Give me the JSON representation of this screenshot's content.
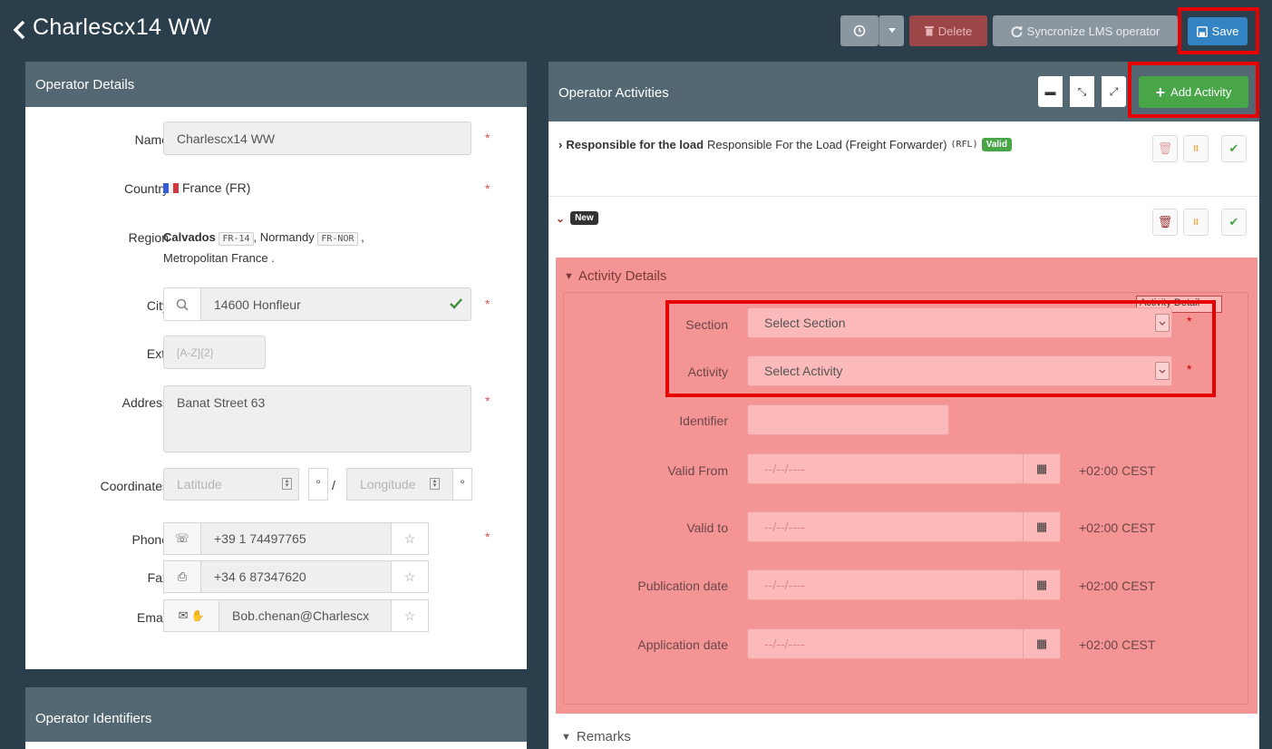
{
  "header": {
    "title": "Charlescx14 WW",
    "delete_label": "Delete",
    "sync_label": "Syncronize LMS operator",
    "save_label": "Save"
  },
  "operator_details": {
    "panel_title": "Operator Details",
    "name_label": "Name",
    "name_value": "Charlescx14 WW",
    "country_label": "Country",
    "country_value": "France (FR)",
    "region_label": "Region",
    "region_name": "Calvados",
    "region_code": "FR-14",
    "region_parent": ", Normandy",
    "region_parent_code": "FR-NOR",
    "region_line2": "Metropolitan France .",
    "city_label": "City",
    "city_value": "14600 Honfleur",
    "ext_label": "Ext.",
    "ext_placeholder": "[A-Z]{2}",
    "address_label": "Address",
    "address_value": "Banat Street 63",
    "coordinates_label": "Coordinates",
    "latitude_placeholder": "Latitude",
    "longitude_placeholder": "Longitude",
    "degree": "°",
    "slash": "/",
    "phone_label": "Phone",
    "phone_value": "+39 1 74497765",
    "fax_label": "Fax",
    "fax_value": "+34 6 87347620",
    "email_label": "Email",
    "email_value": "Bob.chenan@Charlescx"
  },
  "operator_identifiers": {
    "panel_title": "Operator Identifiers"
  },
  "operator_activities": {
    "panel_title": "Operator Activities",
    "add_label": "Add Activity",
    "item1_bold": "Responsible for the load",
    "item1_desc": "Responsible For the Load (Freight Forwarder)",
    "item1_code": "(RFL)",
    "item1_badge": "Valid",
    "item2_badge": "New",
    "details_title": "Activity Details",
    "tooltip": "Activity Detail",
    "section_label": "Section",
    "section_value": "Select Section",
    "activity_label": "Activity",
    "activity_value": "Select Activity",
    "identifier_label": "Identifier",
    "valid_from_label": "Valid From",
    "valid_to_label": "Valid to",
    "publication_label": "Publication date",
    "application_label": "Application date",
    "date_placeholder": "--/--/----",
    "timezone": "+02:00 CEST",
    "remarks_title": "Remarks"
  },
  "colors": {
    "background": "#2b3e4c",
    "panel_header": "#546874",
    "save": "#3483c4",
    "add": "#48a548",
    "delete": "#9c4648",
    "highlight": "#e60000",
    "activity_overlay": "#f49494"
  }
}
